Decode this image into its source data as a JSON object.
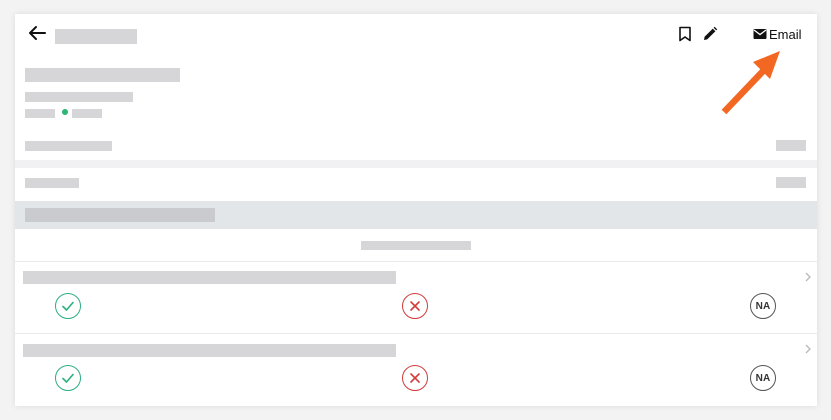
{
  "header": {
    "email_label": "Email",
    "icons": [
      "back-icon",
      "bookmark-icon",
      "pencil-icon",
      "mail-icon"
    ]
  },
  "checklist": {
    "items": [
      {
        "na_label": "NA"
      },
      {
        "na_label": "NA"
      }
    ]
  },
  "colors": {
    "pass": "#2bb07f",
    "fail": "#d23c3c",
    "status_dot": "#2bb673",
    "annotation_arrow": "#f26722"
  }
}
